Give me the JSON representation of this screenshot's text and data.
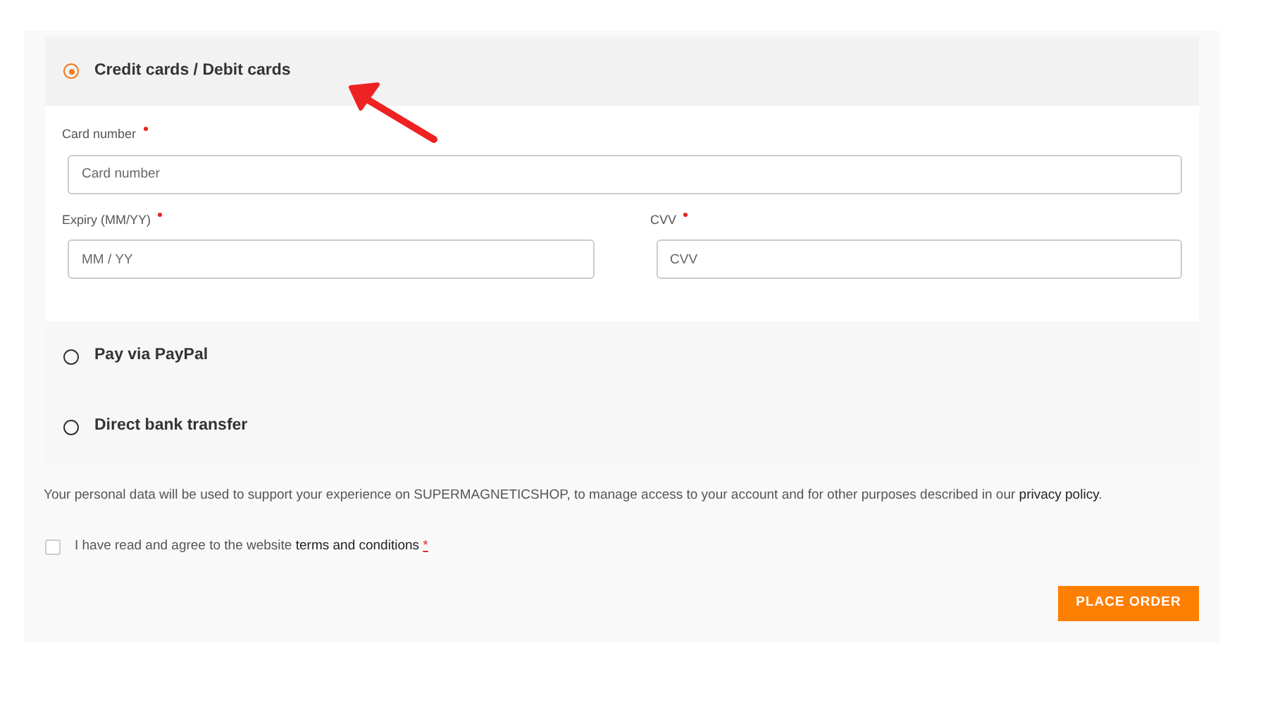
{
  "payment_methods": [
    {
      "label": "Credit cards / Debit cards",
      "selected": true,
      "fields": [
        {
          "label": "Card number",
          "required": true,
          "placeholder": "Card number",
          "kind": "full"
        },
        {
          "label": "Expiry (MM/YY)",
          "required": true,
          "placeholder": "MM / YY",
          "kind": "half"
        },
        {
          "label": "CVV",
          "required": true,
          "placeholder": "CVV",
          "kind": "half"
        }
      ]
    },
    {
      "label": "Pay via PayPal",
      "selected": false
    },
    {
      "label": "Direct bank transfer",
      "selected": false
    }
  ],
  "privacy": {
    "before": "Your personal data will be used to support your experience on SUPERMAGNETICSHOP, to manage access to your account and for other purposes described in our",
    "link": "privacy policy",
    "after": "."
  },
  "terms": {
    "checked": false,
    "before": "I have read and agree to the website",
    "link": "terms and conditions",
    "required_mark": "*"
  },
  "place_order": "PLACE ORDER"
}
